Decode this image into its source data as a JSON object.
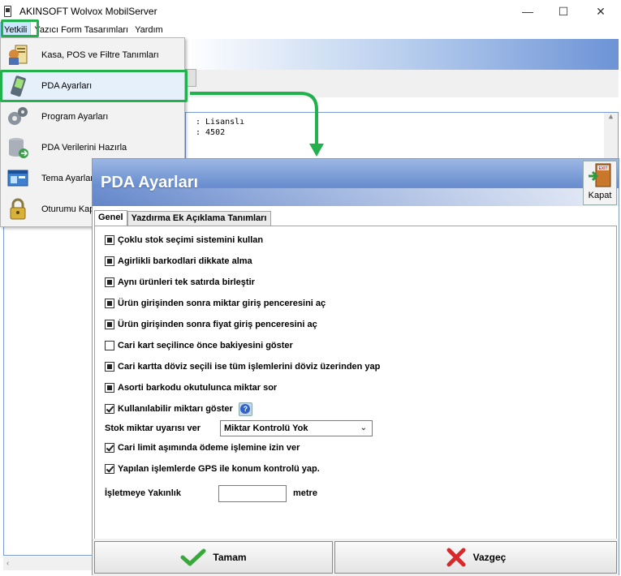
{
  "window": {
    "title": "AKINSOFT Wolvox MobilServer",
    "minimize_glyph": "—",
    "maximize_glyph": "☐",
    "close_glyph": "✕"
  },
  "menubar": {
    "items": [
      "Yetkili",
      "Yazıcı Form Tasarımları",
      "Yardım"
    ]
  },
  "dropdown": {
    "items": [
      {
        "label": "Kasa,  POS ve Filtre Tanımları",
        "icon": "register-icon"
      },
      {
        "label": "PDA Ayarları",
        "icon": "pda-icon"
      },
      {
        "label": "Program Ayarları",
        "icon": "gears-icon"
      },
      {
        "label": "PDA Verilerini Hazırla",
        "icon": "database-icon"
      },
      {
        "label": "Tema Ayarları",
        "icon": "theme-icon"
      },
      {
        "label": "Oturumu Kapat",
        "icon": "lock-icon"
      }
    ]
  },
  "console": {
    "line1": ": Lisanslı",
    "line2": ": 4502"
  },
  "dialog": {
    "title": "PDA Ayarları",
    "close_label": "Kapat",
    "close_icon_text": "EXIT",
    "tabs": [
      "Genel",
      "Yazdırma Ek Açıklama Tanımları"
    ],
    "options": [
      {
        "label": "Çoklu stok seçimi sistemini kullan",
        "state": "indeterminate"
      },
      {
        "label": "Agirlikli barkodlari dikkate alma",
        "state": "indeterminate"
      },
      {
        "label": "Aynı ürünleri tek satırda birleştir",
        "state": "indeterminate"
      },
      {
        "label": "Ürün girişinden sonra miktar giriş penceresini aç",
        "state": "indeterminate"
      },
      {
        "label": "Ürün girişinden sonra fiyat giriş penceresini aç",
        "state": "indeterminate"
      },
      {
        "label": "Cari kart seçilince önce bakiyesini göster",
        "state": "unchecked"
      },
      {
        "label": "Cari kartta döviz seçili ise tüm işlemlerini döviz üzerinden yap",
        "state": "indeterminate"
      },
      {
        "label": "Asorti barkodu okutulunca miktar sor",
        "state": "indeterminate"
      },
      {
        "label": "Kullanılabilir miktarı göster",
        "state": "checked"
      }
    ],
    "stock_warning": {
      "label": "Stok miktar uyarısı ver",
      "selected": "Miktar Kontrolü Yok"
    },
    "options2": [
      {
        "label": "Cari limit aşımında ödeme işlemine izin ver",
        "state": "checked"
      },
      {
        "label": "Yapılan işlemlerde GPS ile konum kontrolü yap.",
        "state": "checked"
      }
    ],
    "distance": {
      "label": "İşletmeye Yakınlık",
      "value": "",
      "unit": "metre"
    },
    "buttons": {
      "ok": "Tamam",
      "cancel": "Vazgeç"
    }
  },
  "colors": {
    "highlight_green": "#22b14c",
    "header_blue": "#6b8fd0"
  }
}
